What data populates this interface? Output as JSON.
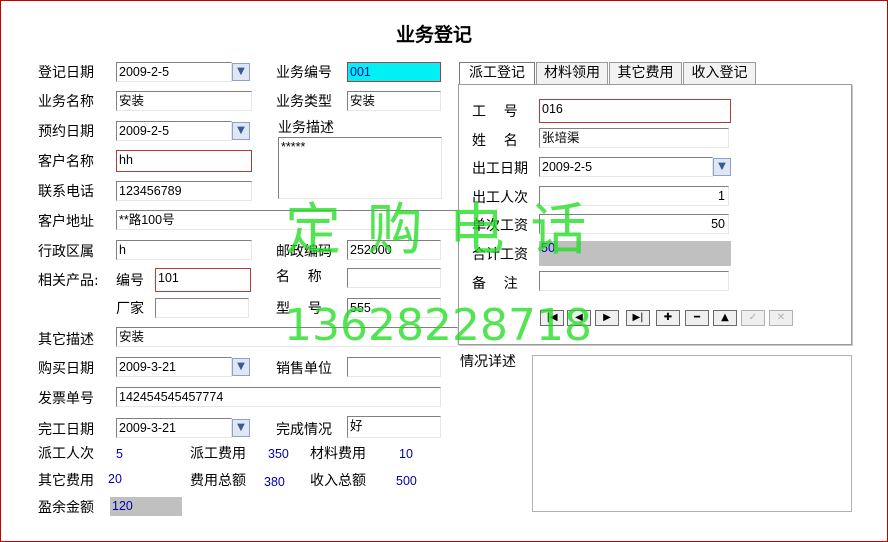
{
  "title": "业务登记",
  "left": {
    "reg_date_label": "登记日期",
    "reg_date": "2009-2-5",
    "biz_no_label": "业务编号",
    "biz_no": "001",
    "biz_name_label": "业务名称",
    "biz_name": "安装",
    "biz_type_label": "业务类型",
    "biz_type": "安装",
    "appt_date_label": "预约日期",
    "appt_date": "2009-2-5",
    "biz_desc_label": "业务描述",
    "biz_desc": "*****",
    "customer_label": "客户名称",
    "customer": "hh",
    "phone_label": "联系电话",
    "phone": "123456789",
    "address_label": "客户地址",
    "address": "**路100号",
    "district_label": "行政区属",
    "district": "h",
    "postcode_label": "邮政编码",
    "postcode": "252000",
    "product_label": "相关产品:",
    "prod_no_label": "编号",
    "prod_no": "101",
    "prod_name_label": "名    称",
    "prod_name": "",
    "maker_label": "厂家",
    "maker": "",
    "model_label": "型    号",
    "model": "555",
    "other_desc_label": "其它描述",
    "other_desc": "安装",
    "buy_date_label": "购买日期",
    "buy_date": "2009-3-21",
    "seller_label": "销售单位",
    "seller": "",
    "invoice_label": "发票单号",
    "invoice": "142454545457774",
    "done_date_label": "完工日期",
    "done_date": "2009-3-21",
    "status_label": "完成情况",
    "status": "好"
  },
  "summary": {
    "workers_label": "派工人次",
    "workers": "5",
    "dispatch_fee_label": "派工费用",
    "dispatch_fee": "350",
    "material_fee_label": "材料费用",
    "material_fee": "10",
    "other_fee_label": "其它费用",
    "other_fee": "20",
    "total_fee_label": "费用总额",
    "total_fee": "380",
    "income_label": "收入总额",
    "income": "500",
    "surplus_label": "盈余金额",
    "surplus": "120"
  },
  "tabs": [
    "派工登记",
    "材料领用",
    "其它费用",
    "收入登记"
  ],
  "dispatch": {
    "emp_no_label": "工    号",
    "emp_no": "016",
    "name_label": "姓    名",
    "name": "张培渠",
    "work_date_label": "出工日期",
    "work_date": "2009-2-5",
    "times_label": "出工人次",
    "times": "1",
    "wage_label": "单次工资",
    "wage": "50",
    "total_wage_label": "合计工资",
    "total_wage": "50",
    "note_label": "备    注",
    "note": ""
  },
  "nav": {
    "first": "|◀",
    "prev": "◀",
    "next": "▶",
    "last": "▶|",
    "add": "✚",
    "delete": "━",
    "up": "▲",
    "save": "✓",
    "cancel": "✕"
  },
  "detail_label": "情况详述",
  "watermark": {
    "line1": "定 购 电 话",
    "line2": "13628228718"
  },
  "colors": {
    "accent": "#00f0f5",
    "border_required": "#b23a3a",
    "watermark": "#22dd22"
  }
}
